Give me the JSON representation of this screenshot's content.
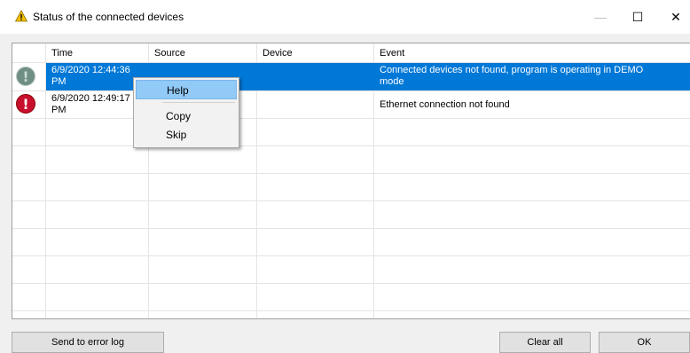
{
  "window": {
    "title": "Status of the connected devices",
    "icon": "warning-icon",
    "controls": {
      "minimize": "—",
      "maximize": "☐",
      "close": "✕"
    }
  },
  "table": {
    "columns": [
      "Time",
      "Source",
      "Device",
      "Event"
    ],
    "rows": [
      {
        "icon": "info-icon",
        "time_line1": "6/9/2020 12:44:36",
        "time_line2": "PM",
        "source": "",
        "device": "",
        "event_line1": "Connected devices not found, program is operating in DEMO",
        "event_line2": "mode",
        "selected": true
      },
      {
        "icon": "error-icon",
        "time_line1": "6/9/2020 12:49:17",
        "time_line2": "PM",
        "source": "",
        "device": "",
        "event_line1": "Ethernet connection not found",
        "event_line2": "",
        "selected": false
      }
    ]
  },
  "context_menu": {
    "items": [
      "Help",
      "Copy",
      "Skip"
    ],
    "highlighted": "Help"
  },
  "buttons": {
    "send_to_error_log": "Send to error log",
    "clear_all": "Clear all",
    "ok": "OK"
  },
  "colors": {
    "selection": "#0078d7",
    "menu_highlight": "#91c9f7",
    "error_red": "#c8102e",
    "warning_yellow": "#f5c000"
  }
}
